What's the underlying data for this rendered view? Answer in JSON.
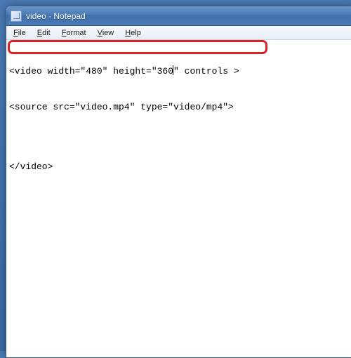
{
  "window": {
    "title": "video - Notepad"
  },
  "menu": {
    "file": "File",
    "edit": "Edit",
    "format": "Format",
    "view": "View",
    "help": "Help"
  },
  "editor": {
    "line1_pre": "<video width=\"480\" height=\"360",
    "line1_post": "\" controls >",
    "line2": "<source src=\"video.mp4\" type=\"video/mp4\">",
    "line3": "",
    "line4": "</video>"
  }
}
